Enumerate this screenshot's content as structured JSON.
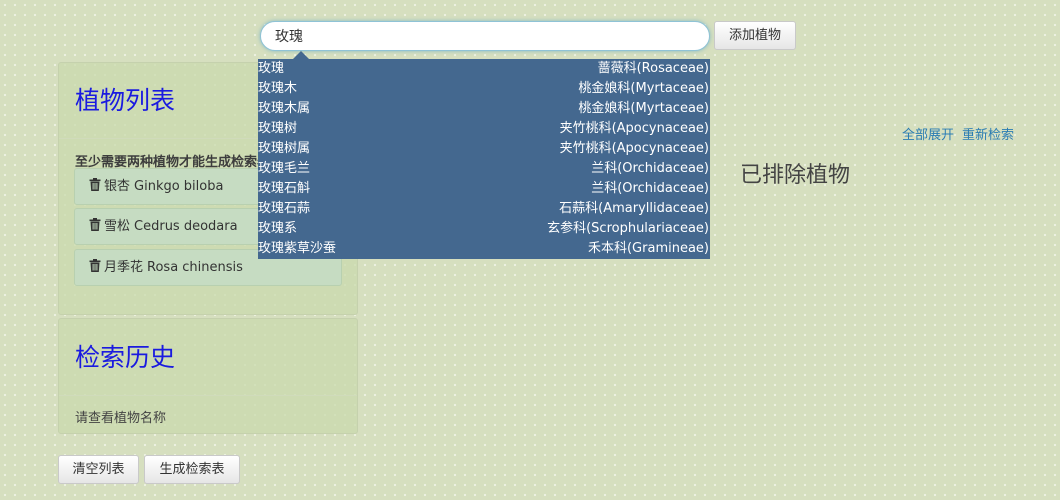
{
  "search": {
    "value": "玫瑰",
    "add_button": "添加植物"
  },
  "autocomplete": [
    {
      "name": "玫瑰",
      "family": "蔷薇科(Rosaceae)"
    },
    {
      "name": "玫瑰木",
      "family": "桃金娘科(Myrtaceae)"
    },
    {
      "name": "玫瑰木属",
      "family": "桃金娘科(Myrtaceae)"
    },
    {
      "name": "玫瑰树",
      "family": "夹竹桃科(Apocynaceae)"
    },
    {
      "name": "玫瑰树属",
      "family": "夹竹桃科(Apocynaceae)"
    },
    {
      "name": "玫瑰毛兰",
      "family": "兰科(Orchidaceae)"
    },
    {
      "name": "玫瑰石斛",
      "family": "兰科(Orchidaceae)"
    },
    {
      "name": "玫瑰石蒜",
      "family": "石蒜科(Amaryllidaceae)"
    },
    {
      "name": "玫瑰系",
      "family": "玄参科(Scrophulariaceae)"
    },
    {
      "name": "玫瑰紫草沙蚕",
      "family": "禾本科(Gramineae)"
    }
  ],
  "plant_list": {
    "title": "植物列表",
    "warning": "至少需要两种植物才能生成检索表",
    "items": [
      {
        "cn": "银杏",
        "latin": "Ginkgo biloba"
      },
      {
        "cn": "雪松",
        "latin": "Cedrus deodara"
      },
      {
        "cn": "月季花",
        "latin": "Rosa chinensis"
      }
    ]
  },
  "history": {
    "title": "检索历史",
    "hint": "请查看植物名称"
  },
  "buttons": {
    "clear": "清空列表",
    "generate": "生成检索表"
  },
  "right": {
    "expand_all": "全部展开",
    "research": "重新检索",
    "excluded_title": "已排除植物"
  },
  "colors": {
    "background": "#d6dfbf",
    "dropdown": "#44688f",
    "panel_title": "#1a1ae0",
    "link": "#2a7cb3"
  }
}
